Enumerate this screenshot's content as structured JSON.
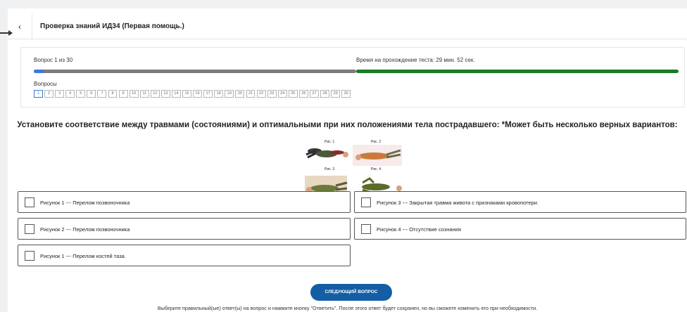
{
  "header": {
    "back_icon": "chevron-left-icon",
    "back_glyph": "‹",
    "title": "Проверка знаний ИД34 (Первая помощь.)"
  },
  "progress": {
    "counter": "Вопрос 1 из 30",
    "fraction": 0.033,
    "timer_text": "Время на прохождение теста: 29 мин. 52 сек.",
    "timer_fraction": 1.0,
    "progress_color": "#3c78d8",
    "timer_color": "#1a7a25"
  },
  "questions_nav": {
    "label": "Вопросы",
    "items": [
      "1",
      "2",
      "3",
      "4",
      "5",
      "6",
      "7",
      "8",
      "9",
      "10",
      "11",
      "12",
      "13",
      "14",
      "15",
      "16",
      "17",
      "18",
      "19",
      "20",
      "21",
      "22",
      "23",
      "24",
      "25",
      "26",
      "27",
      "28",
      "29",
      "30"
    ],
    "active": "1"
  },
  "question": {
    "text": "Установите соответствие между травмами (состояниями) и оптимальными при них положениями тела пострадавшего: *Может быть несколько верных вариантов:"
  },
  "figure": {
    "labels": [
      "Рис. 1",
      "Рис. 2",
      "Рис. 3",
      "Рис. 4"
    ]
  },
  "options": [
    {
      "label": "Рисунок 1 --- Перелом позвоночника"
    },
    {
      "label": "Рисунок 3 --- Закрытая травма живота с признаками кровопотери."
    },
    {
      "label": "Рисунок 2 --- Перелом позвоночника"
    },
    {
      "label": "Рисунок 4 --- Отсутствие сознания"
    },
    {
      "label": "Рисунок 1 --- Перелом костей таза."
    }
  ],
  "actions": {
    "next_label": "СЛЕДУЮЩИЙ ВОПРОС",
    "hint": "Выберите правильный(ые) ответ(ы) на вопрос и нажмите кнопку \"Ответить\". После этого ответ будет сохранен, но вы сможете изменить его при необходимости."
  }
}
